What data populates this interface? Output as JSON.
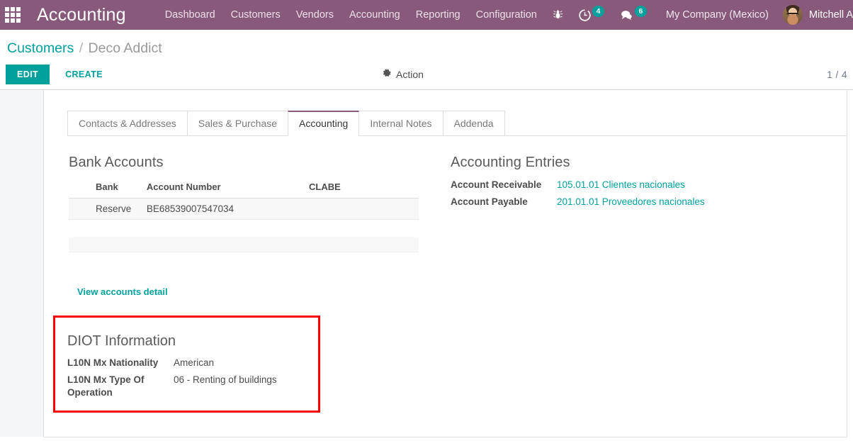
{
  "navbar": {
    "apps_icon": "apps-grid-icon",
    "brand": "Accounting",
    "menu_items": [
      {
        "label": "Dashboard"
      },
      {
        "label": "Customers"
      },
      {
        "label": "Vendors"
      },
      {
        "label": "Accounting"
      },
      {
        "label": "Reporting"
      },
      {
        "label": "Configuration"
      }
    ],
    "systray": {
      "debug_icon": "bug-icon",
      "activities_icon": "clock-icon",
      "activities_count": "4",
      "messages_icon": "chat-bubble-icon",
      "messages_count": "6",
      "company": "My Company (Mexico)",
      "avatar_icon": "user-avatar",
      "username": "Mitchell A"
    },
    "colors": {
      "background": "#875A7B",
      "badge": "#00A09D"
    }
  },
  "control_panel": {
    "breadcrumb": {
      "parent": "Customers",
      "separator": "/",
      "current": "Deco Addict"
    },
    "edit_label": "EDIT",
    "create_label": "CREATE",
    "action_icon": "gear-icon",
    "action_label": "Action",
    "pager": "1 / 4"
  },
  "notebook": {
    "tabs": [
      {
        "label": "Contacts & Addresses",
        "active": false
      },
      {
        "label": "Sales & Purchase",
        "active": false
      },
      {
        "label": "Accounting",
        "active": true
      },
      {
        "label": "Internal Notes",
        "active": false
      },
      {
        "label": "Addenda",
        "active": false
      }
    ],
    "active_tab_color": "#875A7B"
  },
  "bank_accounts": {
    "title": "Bank Accounts",
    "columns": [
      "Bank",
      "Account Number",
      "CLABE"
    ],
    "rows": [
      {
        "bank": "Reserve",
        "account_number": "BE68539007547034",
        "clabe": ""
      }
    ],
    "view_detail_label": "View accounts detail"
  },
  "accounting_entries": {
    "title": "Accounting Entries",
    "fields": [
      {
        "label": "Account Receivable",
        "value": "105.01.01 Clientes nacionales"
      },
      {
        "label": "Account Payable",
        "value": "201.01.01 Proveedores nacionales"
      }
    ]
  },
  "diot": {
    "title": "DIOT Information",
    "highlight_color": "#FF0000",
    "fields": [
      {
        "label": "L10N Mx Nationality",
        "value": "American"
      },
      {
        "label": "L10N Mx Type Of Operation",
        "value": "06 - Renting of buildings"
      }
    ]
  }
}
